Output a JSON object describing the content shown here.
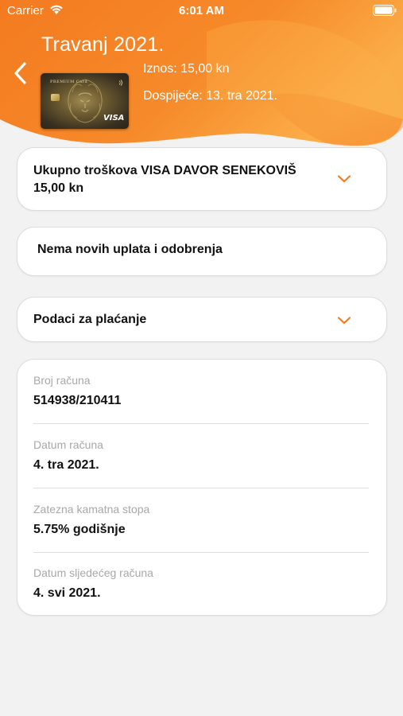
{
  "status_bar": {
    "carrier": "Carrier",
    "time": "6:01 AM"
  },
  "header": {
    "title": "Travanj 2021.",
    "amount": "Iznos: 15,00 kn",
    "due": "Dospijeće: 13. tra 2021.",
    "card": {
      "tier": "PREMIUM Card",
      "network": "VISA"
    },
    "colors": {
      "gradient_start": "#f47a20",
      "gradient_end": "#fbb14a"
    }
  },
  "icons": {
    "back": "chevron-left-icon",
    "expand": "chevron-down-icon",
    "wifi": "wifi-icon",
    "battery": "battery-icon"
  },
  "accent_color": "#f47a20",
  "sections": {
    "total_costs": {
      "title": "Ukupno troškova VISA DAVOR SENEKOVIŠ",
      "amount": "15,00 kn"
    },
    "payments": {
      "title": "Nema novih uplata i odobrenja"
    },
    "payment_info": {
      "title": "Podaci za plaćanje"
    }
  },
  "details": [
    {
      "label": "Broj računa",
      "value": "514938/210411"
    },
    {
      "label": "Datum računa",
      "value": "4. tra 2021."
    },
    {
      "label": "Zatezna kamatna stopa",
      "value": "5.75% godišnje"
    },
    {
      "label": "Datum sljedećeg računa",
      "value": "4. svi 2021."
    }
  ]
}
